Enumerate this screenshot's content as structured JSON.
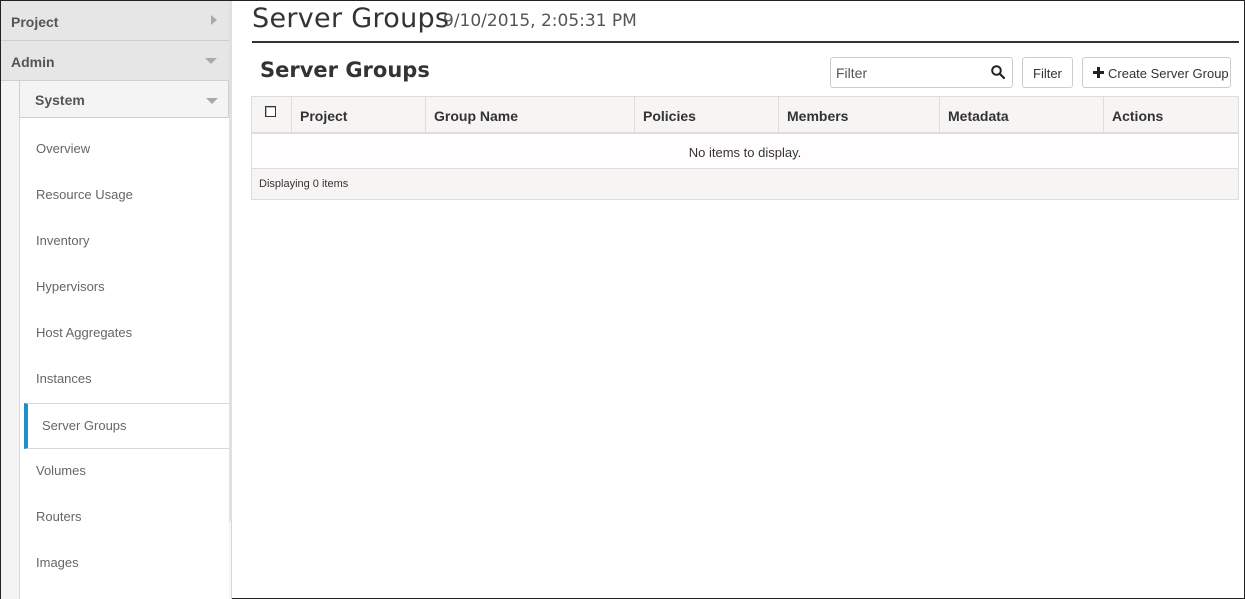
{
  "sidebar": {
    "project_label": "Project",
    "admin_label": "Admin",
    "system_label": "System",
    "items": [
      {
        "label": "Overview"
      },
      {
        "label": "Resource Usage"
      },
      {
        "label": "Inventory"
      },
      {
        "label": "Hypervisors"
      },
      {
        "label": "Host Aggregates"
      },
      {
        "label": "Instances"
      },
      {
        "label": "Server Groups",
        "active": true
      },
      {
        "label": "Volumes"
      },
      {
        "label": "Routers"
      },
      {
        "label": "Images"
      }
    ]
  },
  "header": {
    "title": "Server Groups",
    "timestamp": "9/10/2015, 2:05:31 PM"
  },
  "section": {
    "title": "Server Groups"
  },
  "toolbar": {
    "filter_placeholder": "Filter",
    "filter_button": "Filter",
    "create_button": "Create Server Group"
  },
  "table": {
    "columns": [
      "Project",
      "Group Name",
      "Policies",
      "Members",
      "Metadata",
      "Actions"
    ],
    "empty_message": "No items to display.",
    "footer": "Displaying 0 items"
  },
  "colors": {
    "active_accent": "#1e90c8"
  }
}
